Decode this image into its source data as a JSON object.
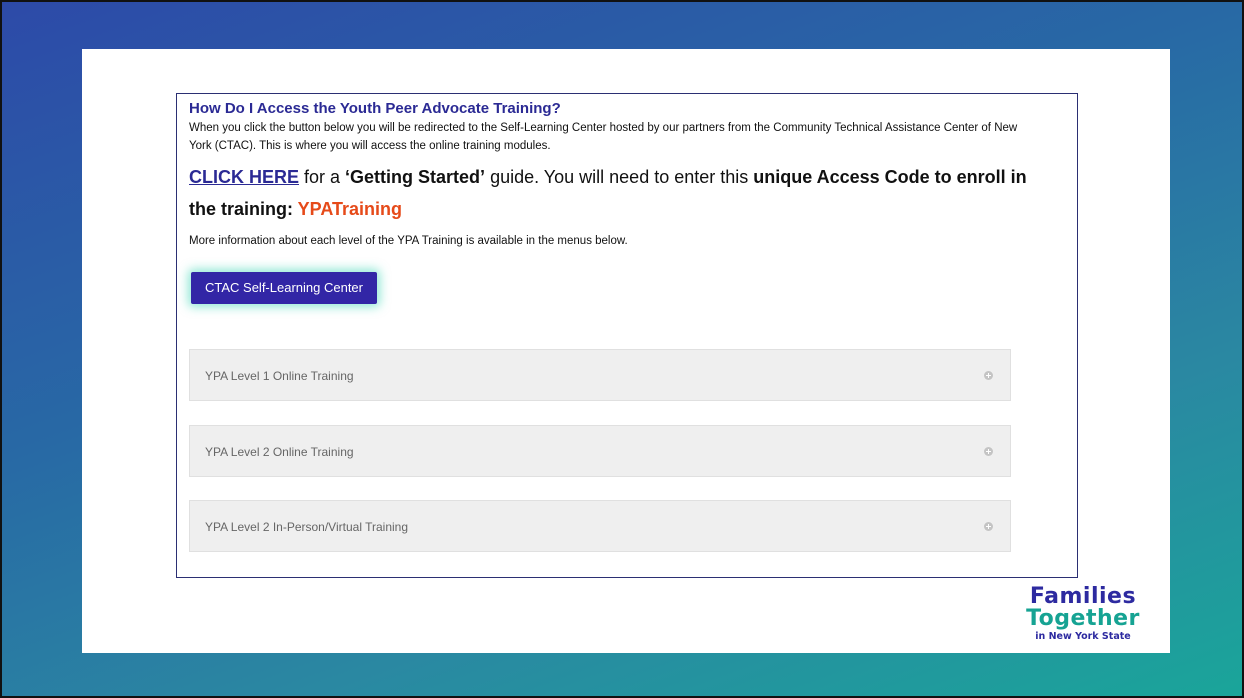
{
  "card": {
    "heading": "How Do I Access the Youth Peer Advocate Training?",
    "intro": "When you click the button below you will be redirected to the Self-Learning Center hosted by our partners from the Community Technical Assistance Center of New York (CTAC). This is where you will access the online training modules.",
    "guide_link": "CLICK HERE",
    "guide_text_1": " for a ",
    "guide_bold_1": "‘Getting Started’",
    "guide_text_2": " guide. You will need to enter this ",
    "guide_bold_2": "unique Access Code to enroll in the training: ",
    "access_code": "YPATraining",
    "more_info": "More information about each level of the YPA Training is available in the menus below.",
    "cta_label": "CTAC Self-Learning Center"
  },
  "accordion": [
    {
      "label": "YPA Level 1 Online Training",
      "expanded": false
    },
    {
      "label": "YPA Level 2 Online Training",
      "expanded": false
    },
    {
      "label": "YPA Level 2 In-Person/Virtual Training",
      "expanded": false
    }
  ],
  "logo": {
    "line1": "Families",
    "line2": "Together",
    "line3": "in New York State"
  },
  "colors": {
    "heading": "#2b2a94",
    "access_code": "#e64a19",
    "button": "#3226a6",
    "logo_purple": "#2d2aa0",
    "logo_teal": "#16a393"
  }
}
